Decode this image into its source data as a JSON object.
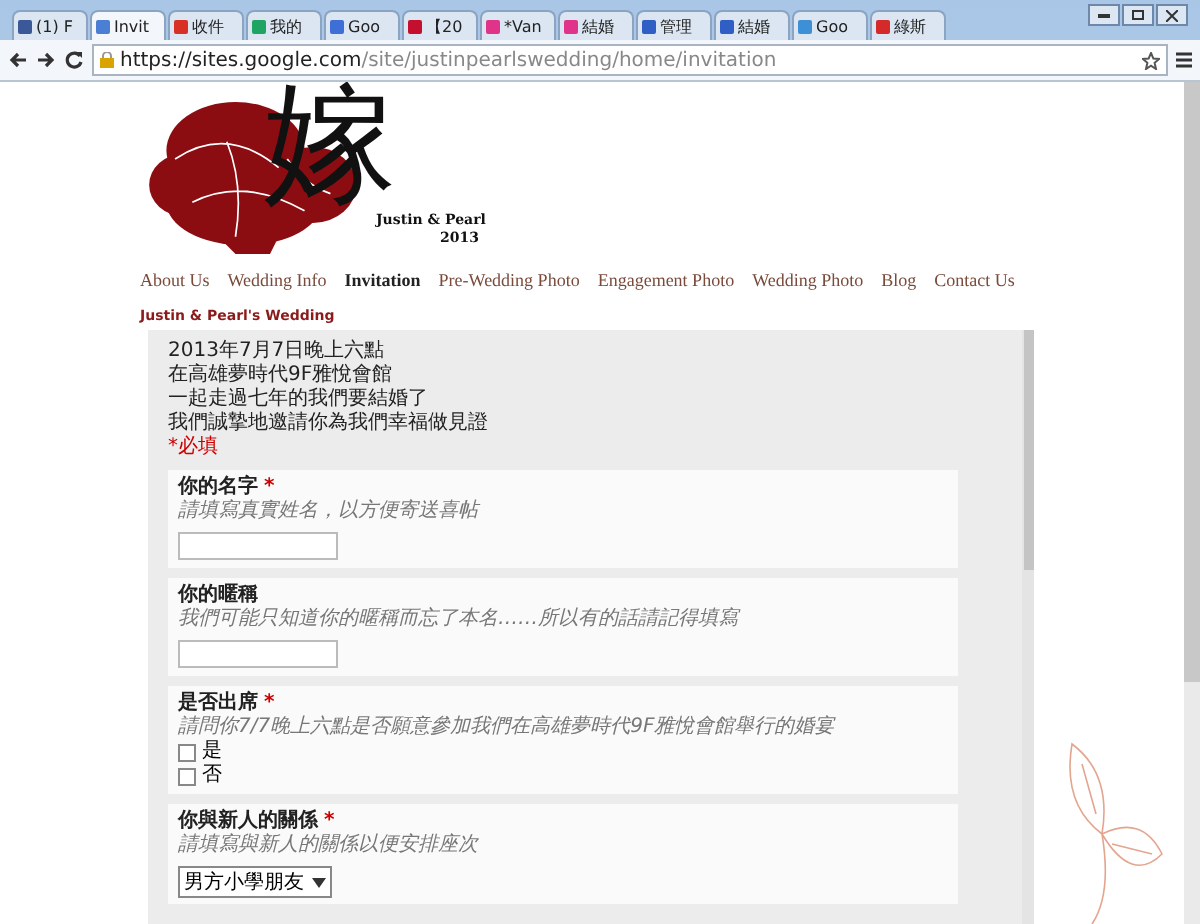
{
  "browser": {
    "tabs": [
      {
        "label": "(1) F",
        "selected": false,
        "color": "#3b5998"
      },
      {
        "label": "Invit",
        "selected": true,
        "color": "#4a7fd4"
      },
      {
        "label": "收件",
        "selected": false,
        "color": "#d93025"
      },
      {
        "label": "我的",
        "selected": false,
        "color": "#1fa463"
      },
      {
        "label": "Goo",
        "selected": false,
        "color": "#3d6fd6"
      },
      {
        "label": "【20",
        "selected": false,
        "color": "#c4102e"
      },
      {
        "label": "*Van",
        "selected": false,
        "color": "#e0338a"
      },
      {
        "label": "結婚",
        "selected": false,
        "color": "#e0338a"
      },
      {
        "label": "管理",
        "selected": false,
        "color": "#2f5fc4"
      },
      {
        "label": "結婚",
        "selected": false,
        "color": "#2f5fc4"
      },
      {
        "label": "Goo",
        "selected": false,
        "color": "#3d8fd6"
      },
      {
        "label": "綠斯",
        "selected": false,
        "color": "#d42a2a"
      }
    ],
    "url_host": "https://sites.google.com",
    "url_path": "/site/justinpearlswedding/home/invitation"
  },
  "logo": {
    "character": "嫁",
    "names": "Justin & Pearl",
    "year": "2013"
  },
  "nav": [
    {
      "label": "About Us",
      "selected": false
    },
    {
      "label": "Wedding Info",
      "selected": false
    },
    {
      "label": "Invitation",
      "selected": true
    },
    {
      "label": "Pre-Wedding Photo",
      "selected": false
    },
    {
      "label": "Engagement Photo",
      "selected": false
    },
    {
      "label": "Wedding Photo",
      "selected": false
    },
    {
      "label": "Blog",
      "selected": false
    },
    {
      "label": "Contact Us",
      "selected": false
    }
  ],
  "page_title": "Justin & Pearl's Wedding",
  "form": {
    "intro": [
      "2013年7月7日晚上六點",
      "在高雄夢時代9F雅悅會館",
      "一起走過七年的我們要結婚了",
      "我們誠摯地邀請你為我們幸福做見證"
    ],
    "required_note": "*必填",
    "required_mark": "*",
    "questions": [
      {
        "kind": "text",
        "title": "你的名字",
        "required": true,
        "hint": "請填寫真實姓名，以方便寄送喜帖"
      },
      {
        "kind": "text",
        "title": "你的暱稱",
        "required": false,
        "hint": "我們可能只知道你的暱稱而忘了本名……所以有的話請記得填寫"
      },
      {
        "kind": "checkboxes",
        "title": "是否出席",
        "required": true,
        "hint": "請問你7/7晚上六點是否願意參加我們在高雄夢時代9F雅悅會館舉行的婚宴",
        "options": [
          {
            "label": "是",
            "checked": false
          },
          {
            "label": "否",
            "checked": false
          }
        ]
      },
      {
        "kind": "select",
        "title": "你與新人的關係",
        "required": true,
        "hint": "請填寫與新人的關係以便安排座次",
        "value": "男方小學朋友"
      }
    ]
  }
}
